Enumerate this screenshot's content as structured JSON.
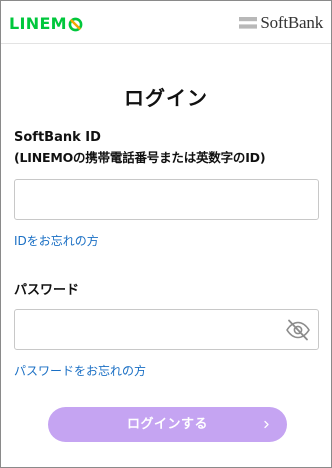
{
  "header": {
    "linemo_logo_text": "LINEM",
    "softbank_logo_text": "SoftBank"
  },
  "page": {
    "title": "ログイン"
  },
  "form": {
    "id_label_line1": "SoftBank ID",
    "id_label_line2": "(LINEMOの携帯電話番号または英数字のID)",
    "id_value": "",
    "forgot_id_link": "IDをお忘れの方",
    "password_label": "パスワード",
    "password_value": "",
    "password_visibility_icon": "eye-slash-icon",
    "forgot_password_link": "パスワードをお忘れの方",
    "login_button": "ログインする",
    "login_button_icon": "chevron-right-icon"
  },
  "colors": {
    "linemo_green": "#00c73c",
    "link_blue": "#1a6fc4",
    "button_purple_disabled": "#c5a4f2"
  }
}
